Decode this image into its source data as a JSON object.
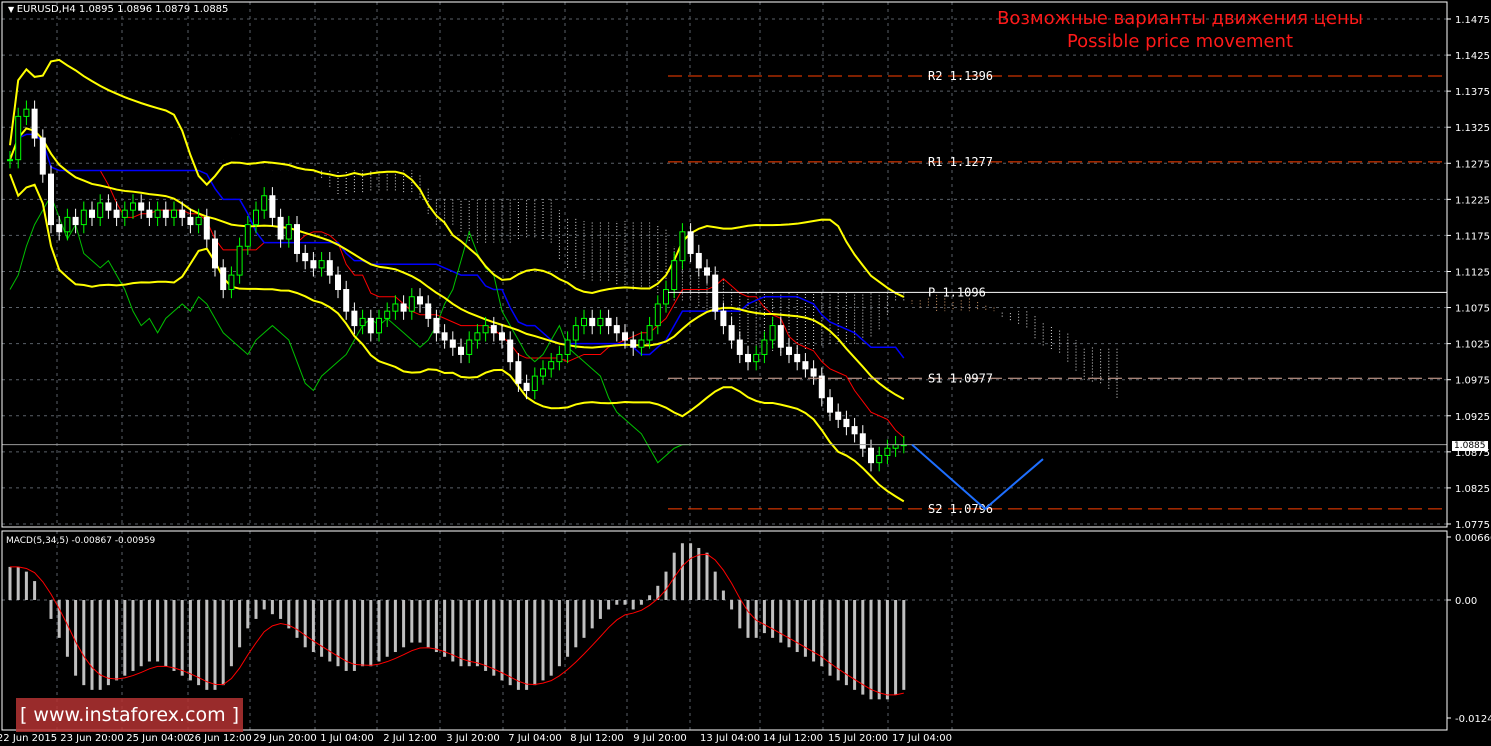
{
  "header": {
    "symbol": "EURUSD,H4",
    "ohlc": "1.0895 1.0896 1.0879 1.0885"
  },
  "caption": {
    "ru": "Возможные варианты движения цены",
    "en": "Possible price movement"
  },
  "logo": "[ www.instaforex.com ]",
  "macd_label": "MACD(5,34,5) -0.00867 -0.00959",
  "current_price": "1.0885",
  "colors": {
    "bull": "#00ff00",
    "bear": "#ffffff",
    "bollinger": "#ffff00",
    "tenkan": "#ff0000",
    "kijun": "#0000ff",
    "chikou": "#00c000",
    "levels": "#ff4000",
    "forecast": "#1e6fff",
    "macd_hist": "#c0c0c0",
    "macd_signal": "#ff0000"
  },
  "chart_data": {
    "type": "candlestick",
    "title": "EURUSD,H4",
    "ylim": [
      1.0775,
      1.1475
    ],
    "y_ticks": [
      "1.1475",
      "1.1425",
      "1.1375",
      "1.1325",
      "1.1275",
      "1.1225",
      "1.1175",
      "1.1125",
      "1.1075",
      "1.1025",
      "1.0975",
      "1.0925",
      "1.0875",
      "1.0825",
      "1.0775"
    ],
    "x_ticks": [
      "22 Jun 2015",
      "23 Jun 20:00",
      "25 Jun 04:00",
      "26 Jun 12:00",
      "29 Jun 20:00",
      "1 Jul 04:00",
      "2 Jul 12:00",
      "3 Jul 20:00",
      "7 Jul 04:00",
      "8 Jul 12:00",
      "9 Jul 20:00",
      "13 Jul 04:00",
      "14 Jul 12:00",
      "15 Jul 20:00",
      "17 Jul 04:00"
    ],
    "closes": [
      1.128,
      1.134,
      1.135,
      1.131,
      1.126,
      1.119,
      1.118,
      1.12,
      1.119,
      1.121,
      1.12,
      1.122,
      1.121,
      1.12,
      1.121,
      1.122,
      1.121,
      1.12,
      1.121,
      1.12,
      1.121,
      1.12,
      1.119,
      1.12,
      1.117,
      1.113,
      1.11,
      1.112,
      1.116,
      1.119,
      1.121,
      1.123,
      1.12,
      1.117,
      1.119,
      1.115,
      1.114,
      1.113,
      1.114,
      1.112,
      1.11,
      1.107,
      1.105,
      1.106,
      1.104,
      1.106,
      1.107,
      1.108,
      1.107,
      1.109,
      1.108,
      1.106,
      1.104,
      1.103,
      1.102,
      1.101,
      1.103,
      1.104,
      1.105,
      1.104,
      1.103,
      1.1,
      1.097,
      1.096,
      1.098,
      1.099,
      1.1,
      1.101,
      1.103,
      1.105,
      1.106,
      1.105,
      1.106,
      1.105,
      1.104,
      1.103,
      1.102,
      1.103,
      1.105,
      1.108,
      1.11,
      1.114,
      1.118,
      1.115,
      1.113,
      1.112,
      1.107,
      1.105,
      1.103,
      1.101,
      1.1,
      1.101,
      1.103,
      1.105,
      1.102,
      1.101,
      1.1,
      1.099,
      1.098,
      1.095,
      1.093,
      1.092,
      1.091,
      1.09,
      1.088,
      1.086,
      1.087,
      1.088,
      1.0885,
      1.0885
    ],
    "levels": [
      {
        "label": "R2",
        "value": "1.1396"
      },
      {
        "label": "R1",
        "value": "1.1277"
      },
      {
        "label": "P",
        "value": "1.1096"
      },
      {
        "label": "S1",
        "value": "1.0977"
      },
      {
        "label": "S2",
        "value": "1.0796"
      }
    ],
    "forecast_path": [
      1.0885,
      1.0796,
      1.0865
    ],
    "macd": {
      "ylim": [
        -0.01249,
        0.00666
      ],
      "y_ticks": [
        "0.00666",
        "0.00",
        "-0.01249"
      ],
      "histogram": [
        0.0035,
        0.0035,
        0.003,
        0.002,
        0.0,
        -0.002,
        -0.004,
        -0.006,
        -0.008,
        -0.009,
        -0.0095,
        -0.0095,
        -0.009,
        -0.0085,
        -0.008,
        -0.0075,
        -0.007,
        -0.0065,
        -0.0065,
        -0.007,
        -0.0075,
        -0.008,
        -0.0085,
        -0.009,
        -0.0095,
        -0.0095,
        -0.009,
        -0.007,
        -0.005,
        -0.003,
        -0.002,
        -0.001,
        -0.0015,
        -0.002,
        -0.003,
        -0.004,
        -0.005,
        -0.0055,
        -0.006,
        -0.0065,
        -0.007,
        -0.0075,
        -0.0075,
        -0.007,
        -0.007,
        -0.0065,
        -0.006,
        -0.0055,
        -0.005,
        -0.0045,
        -0.0045,
        -0.005,
        -0.0055,
        -0.006,
        -0.0065,
        -0.007,
        -0.007,
        -0.007,
        -0.0075,
        -0.008,
        -0.0085,
        -0.009,
        -0.0095,
        -0.0095,
        -0.009,
        -0.0085,
        -0.008,
        -0.007,
        -0.006,
        -0.005,
        -0.004,
        -0.003,
        -0.002,
        -0.001,
        -0.0005,
        -0.0005,
        -0.001,
        -0.0005,
        0.0005,
        0.0015,
        0.003,
        0.005,
        0.006,
        0.006,
        0.0055,
        0.005,
        0.003,
        0.001,
        -0.001,
        -0.003,
        -0.004,
        -0.004,
        -0.0035,
        -0.004,
        -0.0045,
        -0.005,
        -0.0055,
        -0.006,
        -0.0065,
        -0.007,
        -0.008,
        -0.0085,
        -0.009,
        -0.0095,
        -0.01,
        -0.0105,
        -0.0105,
        -0.0105,
        -0.01,
        -0.0095
      ]
    }
  }
}
